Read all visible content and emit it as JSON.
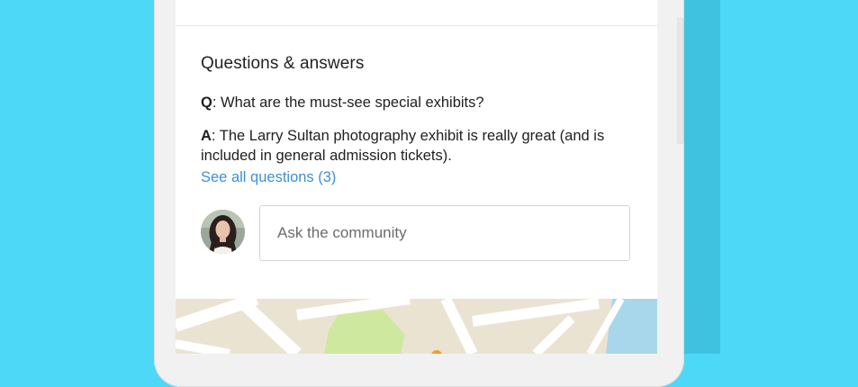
{
  "qa": {
    "title": "Questions & answers",
    "question_prefix": "Q",
    "question_text": ": What are the must-see special exhibits?",
    "answer_prefix": "A",
    "answer_text": ": The Larry Sultan photography exhibit is really great (and is included in general admission tickets).",
    "see_all_label": "See all questions (3)"
  },
  "ask": {
    "placeholder": "Ask the community"
  },
  "colors": {
    "background": "#4dd8f7",
    "link": "#3c8fd6",
    "map_land": "#ebe3d2",
    "map_park": "#cfe8a0",
    "map_water": "#a8d7ec"
  }
}
